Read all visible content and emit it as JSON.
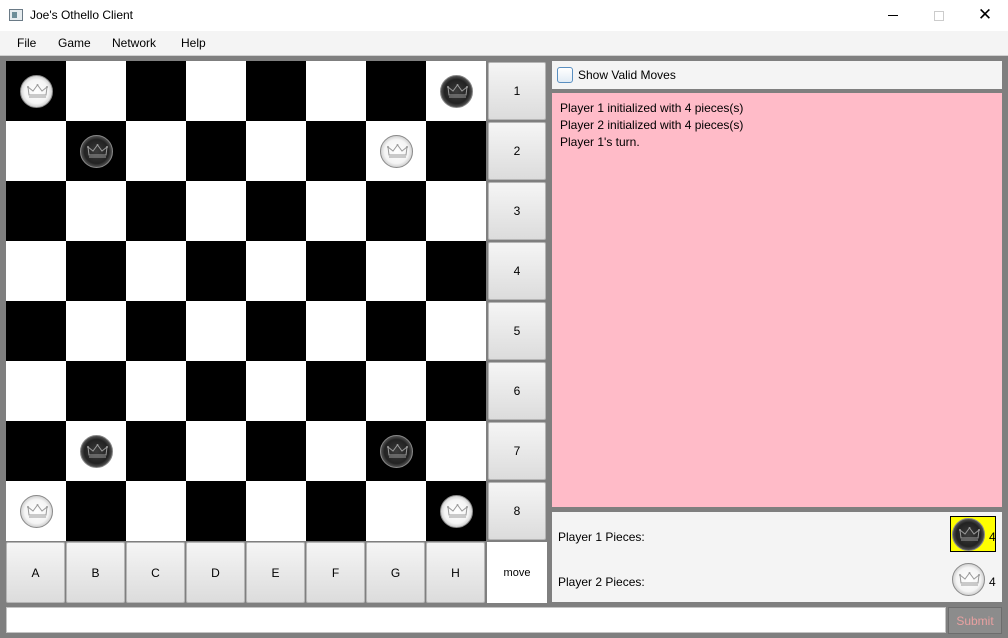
{
  "window": {
    "title": "Joe's Othello Client"
  },
  "menu": {
    "items": [
      "File",
      "Game",
      "Network",
      "Help"
    ]
  },
  "board": {
    "rows": [
      "1",
      "2",
      "3",
      "4",
      "5",
      "6",
      "7",
      "8"
    ],
    "columns": [
      "A",
      "B",
      "C",
      "D",
      "E",
      "F",
      "G",
      "H"
    ],
    "move_label": "move",
    "pieces": [
      {
        "cell": "A1",
        "color": "white"
      },
      {
        "cell": "H1",
        "color": "black"
      },
      {
        "cell": "B2",
        "color": "black"
      },
      {
        "cell": "G2",
        "color": "white"
      },
      {
        "cell": "B7",
        "color": "black"
      },
      {
        "cell": "G7",
        "color": "black"
      },
      {
        "cell": "A8",
        "color": "white"
      },
      {
        "cell": "H8",
        "color": "white"
      }
    ],
    "piece_icon": "crown-icon"
  },
  "options": {
    "show_valid_moves_label": "Show Valid Moves",
    "show_valid_moves_checked": false
  },
  "log": {
    "lines": [
      "Player 1 initialized with 4 pieces(s)",
      "Player 2 initialized with 4 pieces(s)",
      "Player 1's turn."
    ],
    "background": "#ffbbc8"
  },
  "scores": {
    "player1_label": "Player 1 Pieces:",
    "player1_count": "4",
    "player1_color": "black",
    "player2_label": "Player 2 Pieces:",
    "player2_count": "4",
    "player2_color": "white",
    "active_highlight": "#ffff00"
  },
  "footer": {
    "input_value": "",
    "submit_label": "Submit"
  }
}
